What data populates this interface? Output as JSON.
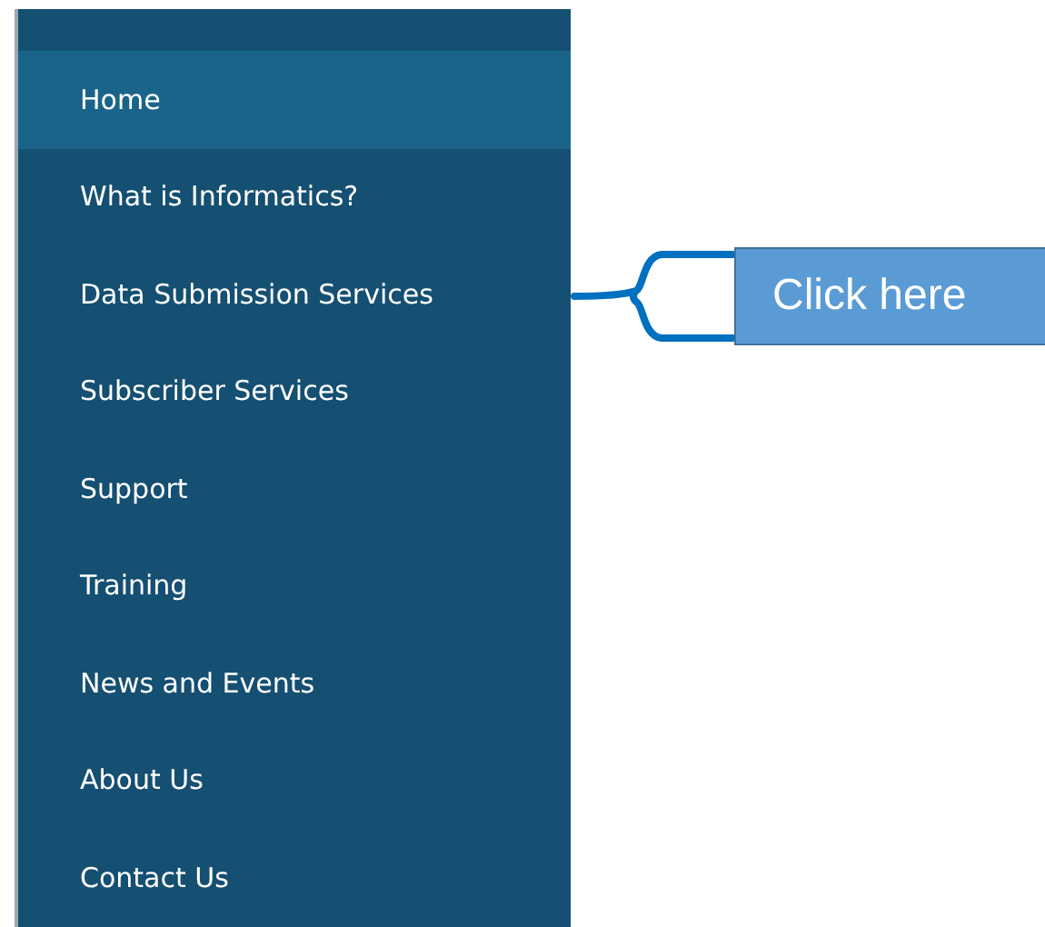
{
  "menu": {
    "items": [
      {
        "label": "Home",
        "selected": true
      },
      {
        "label": "What is Informatics?",
        "selected": false
      },
      {
        "label": "Data Submission Services",
        "selected": false
      },
      {
        "label": "Subscriber Services",
        "selected": false
      },
      {
        "label": "Support",
        "selected": false
      },
      {
        "label": "Training",
        "selected": false
      },
      {
        "label": "News and Events",
        "selected": false
      },
      {
        "label": "About Us",
        "selected": false
      },
      {
        "label": "Contact Us",
        "selected": false
      }
    ]
  },
  "callout": {
    "text": "Click here"
  }
}
